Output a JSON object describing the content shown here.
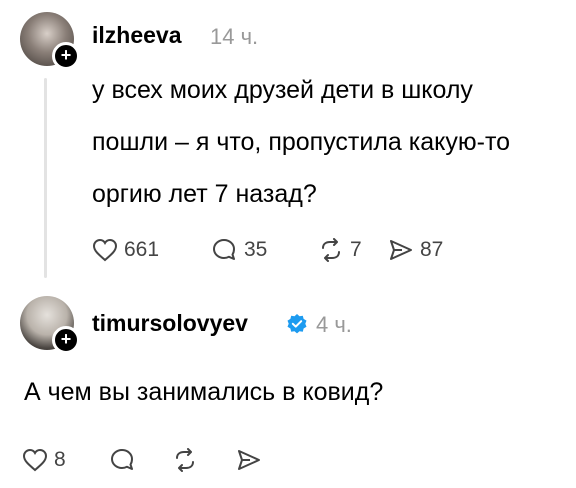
{
  "post": {
    "username": "ilzheeva",
    "time": "14 ч.",
    "text": "у всех моих друзей дети в школу пошли – я что, пропустила какую-то оргию лет 7 назад?",
    "stats": {
      "likes": "661",
      "replies": "35",
      "reposts": "7",
      "shares": "87"
    }
  },
  "reply": {
    "username": "timursolovyev",
    "time": "4 ч.",
    "text": "А чем вы занимались в ковид?",
    "stats": {
      "likes": "8"
    }
  },
  "colors": {
    "verified": "#1d9bf0",
    "muted": "#999999"
  },
  "icons": [
    "heart-icon",
    "comment-icon",
    "repost-icon",
    "share-icon",
    "verified-badge-icon",
    "follow-plus-icon"
  ]
}
